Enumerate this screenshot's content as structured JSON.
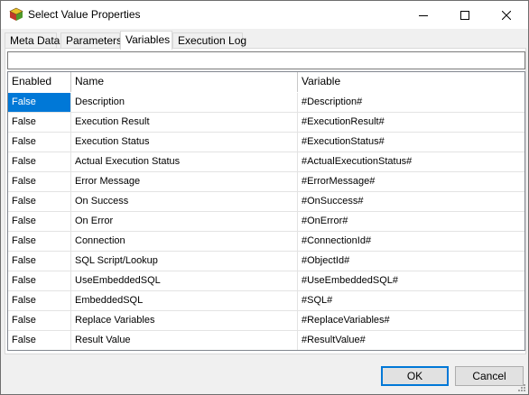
{
  "window": {
    "title": "Select Value Properties",
    "icon": "cube-app-icon"
  },
  "tabs": [
    {
      "label": "Meta Data",
      "active": false
    },
    {
      "label": "Parameters",
      "active": false
    },
    {
      "label": "Variables",
      "active": true
    },
    {
      "label": "Execution Log",
      "active": false
    }
  ],
  "filter": {
    "value": ""
  },
  "grid": {
    "columns": [
      "Enabled",
      "Name",
      "Variable"
    ],
    "rows": [
      {
        "enabled": "False",
        "name": "Description",
        "variable": "#Description#"
      },
      {
        "enabled": "False",
        "name": "Execution Result",
        "variable": "#ExecutionResult#"
      },
      {
        "enabled": "False",
        "name": "Execution Status",
        "variable": "#ExecutionStatus#"
      },
      {
        "enabled": "False",
        "name": "Actual Execution Status",
        "variable": "#ActualExecutionStatus#"
      },
      {
        "enabled": "False",
        "name": "Error Message",
        "variable": "#ErrorMessage#"
      },
      {
        "enabled": "False",
        "name": "On Success",
        "variable": "#OnSuccess#"
      },
      {
        "enabled": "False",
        "name": "On Error",
        "variable": "#OnError#"
      },
      {
        "enabled": "False",
        "name": "Connection",
        "variable": "#ConnectionId#"
      },
      {
        "enabled": "False",
        "name": "SQL Script/Lookup",
        "variable": "#ObjectId#"
      },
      {
        "enabled": "False",
        "name": "UseEmbeddedSQL",
        "variable": "#UseEmbeddedSQL#"
      },
      {
        "enabled": "False",
        "name": "EmbeddedSQL",
        "variable": "#SQL#"
      },
      {
        "enabled": "False",
        "name": "Replace Variables",
        "variable": "#ReplaceVariables#"
      },
      {
        "enabled": "False",
        "name": "Result Value",
        "variable": "#ResultValue#"
      }
    ],
    "selected_row": 0,
    "selection_color": "#0078d7"
  },
  "buttons": {
    "ok": "OK",
    "cancel": "Cancel"
  }
}
